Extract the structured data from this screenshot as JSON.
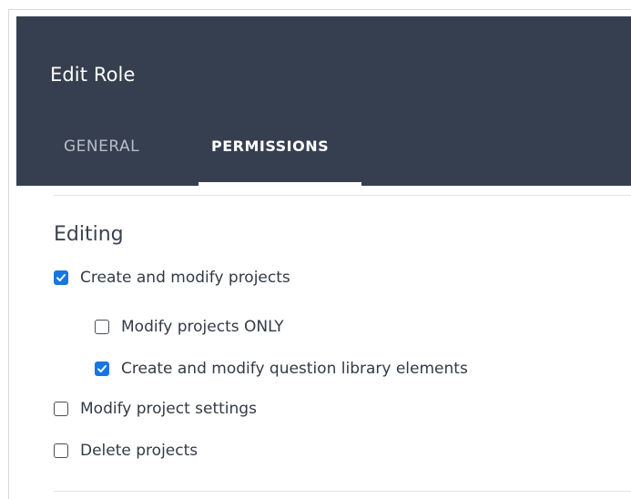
{
  "dialog": {
    "title": "Edit Role",
    "tabs": [
      {
        "label": "GENERAL",
        "active": false
      },
      {
        "label": "PERMISSIONS",
        "active": true
      }
    ]
  },
  "editing": {
    "heading": "Editing",
    "permissions": [
      {
        "label": "Create and modify projects",
        "checked": true,
        "indent": 0
      },
      {
        "label": "Modify projects ONLY",
        "checked": false,
        "indent": 1
      },
      {
        "label": "Create and modify question library elements",
        "checked": true,
        "indent": 1
      },
      {
        "label": "Modify project settings",
        "checked": false,
        "indent": 0
      },
      {
        "label": "Delete projects",
        "checked": false,
        "indent": 0
      }
    ]
  },
  "colors": {
    "header_bg": "#363f4f",
    "checkbox_checked": "#1677e3",
    "active_tab_text": "#ffffff",
    "inactive_tab_text": "#b8bec8"
  },
  "icons": {
    "checkbox_checked": "check-icon"
  }
}
